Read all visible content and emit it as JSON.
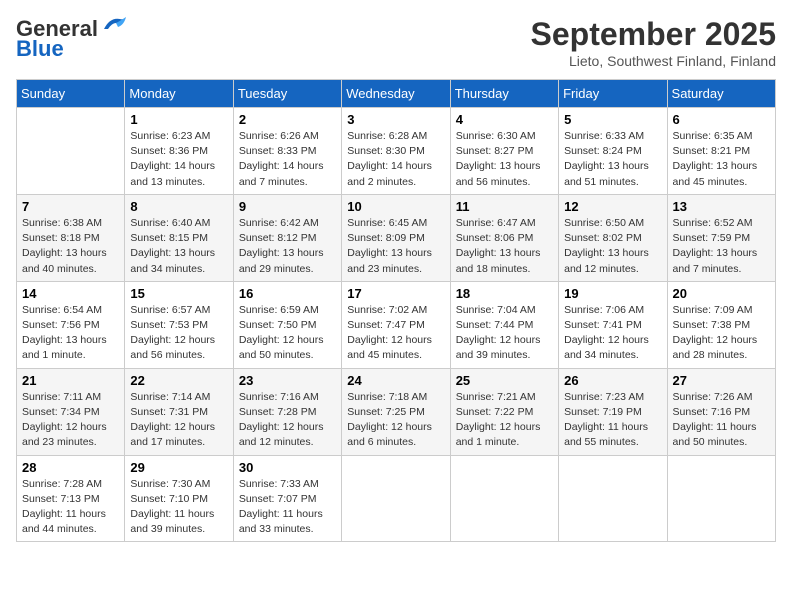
{
  "logo": {
    "general": "General",
    "blue": "Blue"
  },
  "title": "September 2025",
  "subtitle": "Lieto, Southwest Finland, Finland",
  "weekdays": [
    "Sunday",
    "Monday",
    "Tuesday",
    "Wednesday",
    "Thursday",
    "Friday",
    "Saturday"
  ],
  "weeks": [
    [
      {
        "day": "",
        "info": ""
      },
      {
        "day": "1",
        "info": "Sunrise: 6:23 AM\nSunset: 8:36 PM\nDaylight: 14 hours\nand 13 minutes."
      },
      {
        "day": "2",
        "info": "Sunrise: 6:26 AM\nSunset: 8:33 PM\nDaylight: 14 hours\nand 7 minutes."
      },
      {
        "day": "3",
        "info": "Sunrise: 6:28 AM\nSunset: 8:30 PM\nDaylight: 14 hours\nand 2 minutes."
      },
      {
        "day": "4",
        "info": "Sunrise: 6:30 AM\nSunset: 8:27 PM\nDaylight: 13 hours\nand 56 minutes."
      },
      {
        "day": "5",
        "info": "Sunrise: 6:33 AM\nSunset: 8:24 PM\nDaylight: 13 hours\nand 51 minutes."
      },
      {
        "day": "6",
        "info": "Sunrise: 6:35 AM\nSunset: 8:21 PM\nDaylight: 13 hours\nand 45 minutes."
      }
    ],
    [
      {
        "day": "7",
        "info": "Sunrise: 6:38 AM\nSunset: 8:18 PM\nDaylight: 13 hours\nand 40 minutes."
      },
      {
        "day": "8",
        "info": "Sunrise: 6:40 AM\nSunset: 8:15 PM\nDaylight: 13 hours\nand 34 minutes."
      },
      {
        "day": "9",
        "info": "Sunrise: 6:42 AM\nSunset: 8:12 PM\nDaylight: 13 hours\nand 29 minutes."
      },
      {
        "day": "10",
        "info": "Sunrise: 6:45 AM\nSunset: 8:09 PM\nDaylight: 13 hours\nand 23 minutes."
      },
      {
        "day": "11",
        "info": "Sunrise: 6:47 AM\nSunset: 8:06 PM\nDaylight: 13 hours\nand 18 minutes."
      },
      {
        "day": "12",
        "info": "Sunrise: 6:50 AM\nSunset: 8:02 PM\nDaylight: 13 hours\nand 12 minutes."
      },
      {
        "day": "13",
        "info": "Sunrise: 6:52 AM\nSunset: 7:59 PM\nDaylight: 13 hours\nand 7 minutes."
      }
    ],
    [
      {
        "day": "14",
        "info": "Sunrise: 6:54 AM\nSunset: 7:56 PM\nDaylight: 13 hours\nand 1 minute."
      },
      {
        "day": "15",
        "info": "Sunrise: 6:57 AM\nSunset: 7:53 PM\nDaylight: 12 hours\nand 56 minutes."
      },
      {
        "day": "16",
        "info": "Sunrise: 6:59 AM\nSunset: 7:50 PM\nDaylight: 12 hours\nand 50 minutes."
      },
      {
        "day": "17",
        "info": "Sunrise: 7:02 AM\nSunset: 7:47 PM\nDaylight: 12 hours\nand 45 minutes."
      },
      {
        "day": "18",
        "info": "Sunrise: 7:04 AM\nSunset: 7:44 PM\nDaylight: 12 hours\nand 39 minutes."
      },
      {
        "day": "19",
        "info": "Sunrise: 7:06 AM\nSunset: 7:41 PM\nDaylight: 12 hours\nand 34 minutes."
      },
      {
        "day": "20",
        "info": "Sunrise: 7:09 AM\nSunset: 7:38 PM\nDaylight: 12 hours\nand 28 minutes."
      }
    ],
    [
      {
        "day": "21",
        "info": "Sunrise: 7:11 AM\nSunset: 7:34 PM\nDaylight: 12 hours\nand 23 minutes."
      },
      {
        "day": "22",
        "info": "Sunrise: 7:14 AM\nSunset: 7:31 PM\nDaylight: 12 hours\nand 17 minutes."
      },
      {
        "day": "23",
        "info": "Sunrise: 7:16 AM\nSunset: 7:28 PM\nDaylight: 12 hours\nand 12 minutes."
      },
      {
        "day": "24",
        "info": "Sunrise: 7:18 AM\nSunset: 7:25 PM\nDaylight: 12 hours\nand 6 minutes."
      },
      {
        "day": "25",
        "info": "Sunrise: 7:21 AM\nSunset: 7:22 PM\nDaylight: 12 hours\nand 1 minute."
      },
      {
        "day": "26",
        "info": "Sunrise: 7:23 AM\nSunset: 7:19 PM\nDaylight: 11 hours\nand 55 minutes."
      },
      {
        "day": "27",
        "info": "Sunrise: 7:26 AM\nSunset: 7:16 PM\nDaylight: 11 hours\nand 50 minutes."
      }
    ],
    [
      {
        "day": "28",
        "info": "Sunrise: 7:28 AM\nSunset: 7:13 PM\nDaylight: 11 hours\nand 44 minutes."
      },
      {
        "day": "29",
        "info": "Sunrise: 7:30 AM\nSunset: 7:10 PM\nDaylight: 11 hours\nand 39 minutes."
      },
      {
        "day": "30",
        "info": "Sunrise: 7:33 AM\nSunset: 7:07 PM\nDaylight: 11 hours\nand 33 minutes."
      },
      {
        "day": "",
        "info": ""
      },
      {
        "day": "",
        "info": ""
      },
      {
        "day": "",
        "info": ""
      },
      {
        "day": "",
        "info": ""
      }
    ]
  ]
}
